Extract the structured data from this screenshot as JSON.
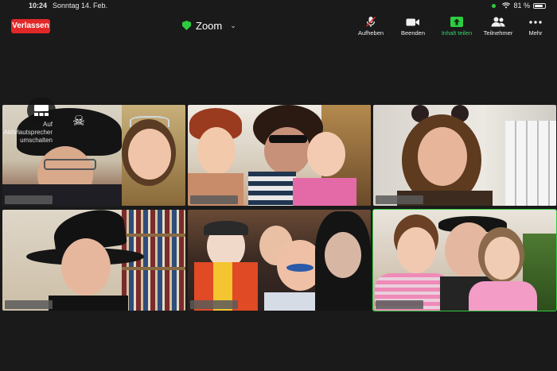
{
  "status": {
    "time": "10:24",
    "date": "Sonntag 14. Feb.",
    "battery": "81 %"
  },
  "meeting": {
    "leave_label": "Verlassen",
    "app_title": "Zoom"
  },
  "toolbar": {
    "items": [
      {
        "label": "Aufheben",
        "icon": "mic-muted-icon"
      },
      {
        "label": "Beenden",
        "icon": "video-camera-icon"
      },
      {
        "label": "Inhalt teilen",
        "icon": "share-screen-icon"
      },
      {
        "label": "Teilnehmer",
        "icon": "participants-icon"
      },
      {
        "label": "Mehr",
        "icon": "more-icon"
      }
    ]
  },
  "layout_button": {
    "hint": "Auf Aktivlautsprecher umschalten"
  },
  "colors": {
    "leave": "#e02828",
    "accent_green": "#2ecc40",
    "background": "#1a1a1a"
  },
  "participants": [
    {
      "tile": 1,
      "active": false
    },
    {
      "tile": 2,
      "active": false
    },
    {
      "tile": 3,
      "active": false
    },
    {
      "tile": 4,
      "active": false
    },
    {
      "tile": 5,
      "active": false
    },
    {
      "tile": 6,
      "active": true
    }
  ]
}
